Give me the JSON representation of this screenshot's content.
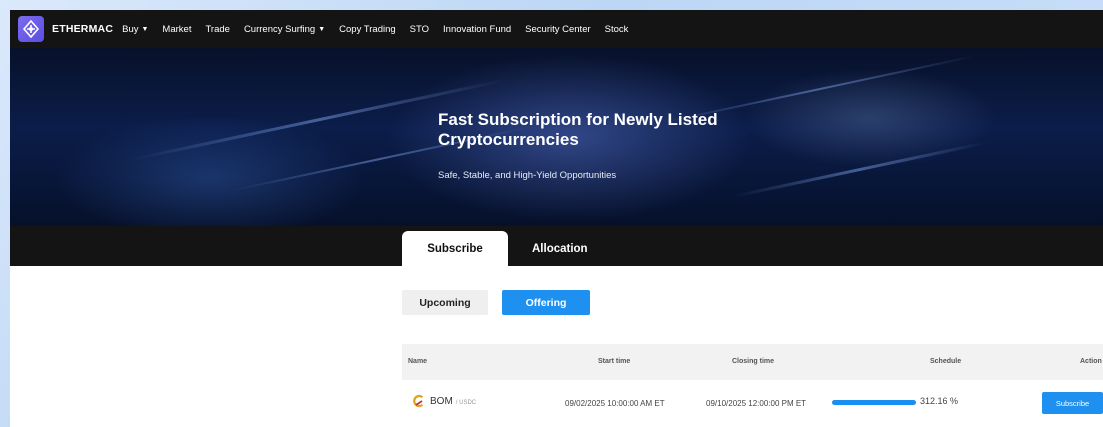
{
  "nav": {
    "brand": "ETHERMAC",
    "items": [
      {
        "label": "Buy",
        "dropdown": true
      },
      {
        "label": "Market",
        "dropdown": false
      },
      {
        "label": "Trade",
        "dropdown": false
      },
      {
        "label": "Currency Surfing",
        "dropdown": true
      },
      {
        "label": "Copy Trading",
        "dropdown": false
      },
      {
        "label": "STO",
        "dropdown": false
      },
      {
        "label": "Innovation Fund",
        "dropdown": false
      },
      {
        "label": "Security Center",
        "dropdown": false
      },
      {
        "label": "Stock",
        "dropdown": false
      }
    ],
    "dropdown_glyph": "▼"
  },
  "banner": {
    "title": "Fast Subscription for Newly Listed Cryptocurrencies",
    "subtitle": "Safe, Stable, and High-Yield Opportunities"
  },
  "tabs": {
    "subscribe": "Subscribe",
    "allocation": "Allocation",
    "active": "subscribe"
  },
  "filters": {
    "upcoming": "Upcoming",
    "offering": "Offering",
    "active": "offering"
  },
  "table": {
    "headers": {
      "name": "Name",
      "start_time": "Start time",
      "closing_time": "Closing time",
      "schedule": "Schedule",
      "action": "Action"
    },
    "rows": [
      {
        "coin": "BOM",
        "quote": "/ USDC",
        "start_time": "09/02/2025 10:00:00 AM ET",
        "closing_time": "09/10/2025 12:00:00 PM ET",
        "progress_fraction": 1.0,
        "schedule": "312.16 %",
        "action": "Subscribe"
      }
    ]
  },
  "colors": {
    "accent": "#1e90f0",
    "nav_bg": "#141414",
    "brand_logo": "#6c5ce7"
  },
  "icons": {
    "logo": "ethermac-logo-icon",
    "coin": "bom-coin-icon",
    "dropdown": "caret-down-icon"
  }
}
